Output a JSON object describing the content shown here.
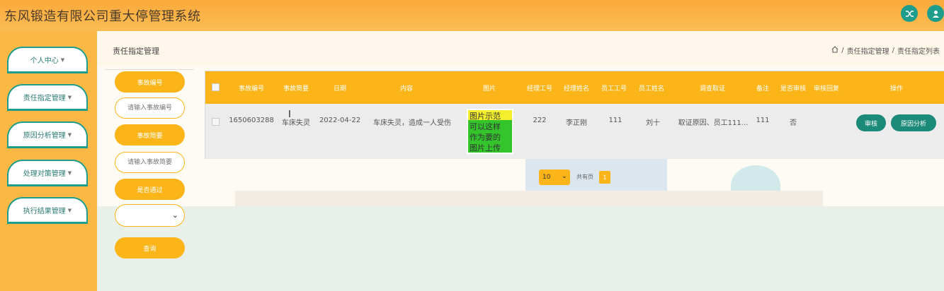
{
  "app": {
    "title": "东风锻造有限公司重大停管理系统"
  },
  "header": {
    "switch_icon": "shuffle-icon",
    "user_icon": "user-icon"
  },
  "sidebar": {
    "items": [
      {
        "label": "个人中心"
      },
      {
        "label": "责任指定管理"
      },
      {
        "label": "原因分析管理"
      },
      {
        "label": "处理对策管理"
      },
      {
        "label": "执行结果管理"
      }
    ]
  },
  "page": {
    "title": "责任指定管理",
    "breadcrumb": {
      "home_icon": "home-icon",
      "level1": "责任指定管理",
      "sep": "/",
      "level2": "责任指定列表"
    }
  },
  "search": {
    "accident_no_label": "事故编号",
    "accident_no_placeholder": "请输入事故编号",
    "accident_type_label": "事故简要",
    "accident_type_placeholder": "请输入事故简要",
    "passed_label": "是否通过",
    "passed_value": "",
    "reset_label": "查询"
  },
  "table": {
    "headers": [
      "事故编号",
      "事故简要",
      "日期",
      "内容",
      "图片",
      "经理工号",
      "经理姓名",
      "员工工号",
      "员工姓名",
      "调查取证",
      "备注",
      "是否审核",
      "审核回复",
      "操作"
    ],
    "rows": [
      {
        "accident_no": "1650603288",
        "summary": "车床失灵",
        "date": "2022-04-22",
        "content": "车床失灵，造成一人受伤",
        "image_text": "图片示范 可以这样 作为要的 图片上传",
        "manager_no": "222",
        "manager_name": "李正刚",
        "employee_no": "111",
        "employee_name": "刘十",
        "evidence": "取证原因、员工111...",
        "remark": "111",
        "audited": "否",
        "audit_reply": "",
        "btn_audit": "审核",
        "btn_analysis": "原因分析"
      }
    ]
  },
  "pagination": {
    "page_size": "10",
    "label": "共有页",
    "current": "1"
  },
  "colors": {
    "accent": "#fcb519",
    "teal": "#1b8a78",
    "header_bg": "#fba93a"
  }
}
